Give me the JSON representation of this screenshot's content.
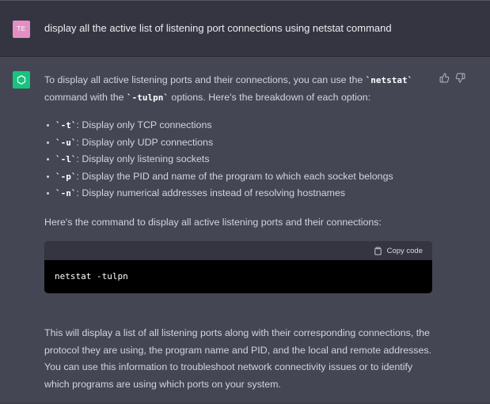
{
  "user_message": {
    "avatar_initials": "TE",
    "text": "display all the active list of listening port connections using netstat command"
  },
  "assistant_message": {
    "avatar_icon": "openai-logo-icon",
    "intro": {
      "p1": "To display all active listening ports and their connections, you can use the ",
      "cmd": "`netstat`",
      "p2": " command with the ",
      "flags": "`-tulpn`",
      "p3": " options. Here's the breakdown of each option:"
    },
    "options": [
      {
        "flag": "`-t`",
        "desc": ": Display only TCP connections"
      },
      {
        "flag": "`-u`",
        "desc": ": Display only UDP connections"
      },
      {
        "flag": "`-l`",
        "desc": ": Display only listening sockets"
      },
      {
        "flag": "`-p`",
        "desc": ": Display the PID and name of the program to which each socket belongs"
      },
      {
        "flag": "`-n`",
        "desc": ": Display numerical addresses instead of resolving hostnames"
      }
    ],
    "command_intro": "Here's the command to display all active listening ports and their connections:",
    "code_block": {
      "copy_label": "Copy code",
      "code": "netstat -tulpn"
    },
    "conclusion": "This will display a list of all listening ports along with their corresponding connections, the protocol they are using, the program name and PID, and the local and remote addresses. You can use this information to troubleshoot network connectivity issues or to identify which programs are using which ports on your system."
  },
  "colors": {
    "user_bg": "#343541",
    "assistant_bg": "#444654",
    "bot_avatar": "#19c37d",
    "user_avatar": "#e38fc3"
  }
}
